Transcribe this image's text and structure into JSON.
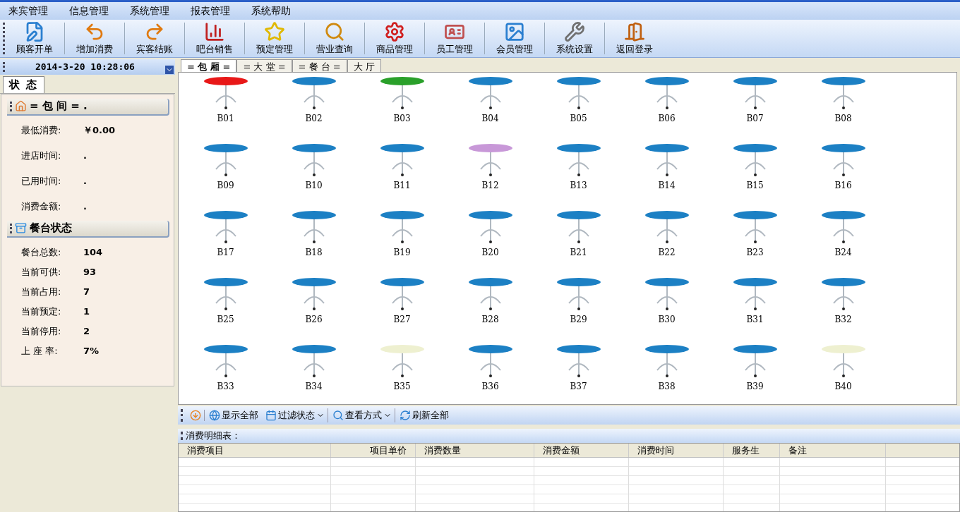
{
  "menu": [
    "来宾管理",
    "信息管理",
    "系统管理",
    "报表管理",
    "系统帮助"
  ],
  "toolbar": [
    "顾客开单",
    "增加消费",
    "宾客结账",
    "吧台销售",
    "预定管理",
    "营业查询",
    "商品管理",
    "员工管理",
    "会员管理",
    "系统设置",
    "返回登录"
  ],
  "clock": "2014-3-20  10:28:06",
  "left_tabs": [
    {
      "label": "状 态",
      "selected": true
    }
  ],
  "room_section": {
    "title": "= 包 间 = .",
    "fields": [
      {
        "label": "最低消费:",
        "value": "￥0.00"
      },
      {
        "label": "进店时间:",
        "value": "."
      },
      {
        "label": "已用时间:",
        "value": "."
      },
      {
        "label": "消费金额:",
        "value": "."
      }
    ]
  },
  "status_section": {
    "title": "餐台状态",
    "fields": [
      {
        "label": "餐台总数:",
        "value": "104"
      },
      {
        "label": "当前可供:",
        "value": "93"
      },
      {
        "label": "当前占用:",
        "value": "7"
      },
      {
        "label": "当前预定:",
        "value": "1"
      },
      {
        "label": "当前停用:",
        "value": "2"
      },
      {
        "label": "上 座 率:",
        "value": "7%"
      }
    ]
  },
  "area_tabs": [
    {
      "label": "= 包 厢 =",
      "selected": true
    },
    {
      "label": "= 大 堂 =",
      "selected": false
    },
    {
      "label": "= 餐 台 =",
      "selected": false
    },
    {
      "label": "大 厅",
      "selected": false
    }
  ],
  "tables": [
    {
      "name": "B01",
      "color": "#e81818"
    },
    {
      "name": "B02",
      "color": "#1c80c4"
    },
    {
      "name": "B03",
      "color": "#2aa02a"
    },
    {
      "name": "B04",
      "color": "#1c80c4"
    },
    {
      "name": "B05",
      "color": "#1c80c4"
    },
    {
      "name": "B06",
      "color": "#1c80c4"
    },
    {
      "name": "B07",
      "color": "#1c80c4"
    },
    {
      "name": "B08",
      "color": "#1c80c4"
    },
    {
      "name": "B09",
      "color": "#1c80c4"
    },
    {
      "name": "B10",
      "color": "#1c80c4"
    },
    {
      "name": "B11",
      "color": "#1c80c4"
    },
    {
      "name": "B12",
      "color": "#c898d8"
    },
    {
      "name": "B13",
      "color": "#1c80c4"
    },
    {
      "name": "B14",
      "color": "#1c80c4"
    },
    {
      "name": "B15",
      "color": "#1c80c4"
    },
    {
      "name": "B16",
      "color": "#1c80c4"
    },
    {
      "name": "B17",
      "color": "#1c80c4"
    },
    {
      "name": "B18",
      "color": "#1c80c4"
    },
    {
      "name": "B19",
      "color": "#1c80c4"
    },
    {
      "name": "B20",
      "color": "#1c80c4"
    },
    {
      "name": "B21",
      "color": "#1c80c4"
    },
    {
      "name": "B22",
      "color": "#1c80c4"
    },
    {
      "name": "B23",
      "color": "#1c80c4"
    },
    {
      "name": "B24",
      "color": "#1c80c4"
    },
    {
      "name": "B25",
      "color": "#1c80c4"
    },
    {
      "name": "B26",
      "color": "#1c80c4"
    },
    {
      "name": "B27",
      "color": "#1c80c4"
    },
    {
      "name": "B28",
      "color": "#1c80c4"
    },
    {
      "name": "B29",
      "color": "#1c80c4"
    },
    {
      "name": "B30",
      "color": "#1c80c4"
    },
    {
      "name": "B31",
      "color": "#1c80c4"
    },
    {
      "name": "B32",
      "color": "#1c80c4"
    },
    {
      "name": "B33",
      "color": "#1c80c4"
    },
    {
      "name": "B34",
      "color": "#1c80c4"
    },
    {
      "name": "B35",
      "color": "#eef0d0"
    },
    {
      "name": "B36",
      "color": "#1c80c4"
    },
    {
      "name": "B37",
      "color": "#1c80c4"
    },
    {
      "name": "B38",
      "color": "#1c80c4"
    },
    {
      "name": "B39",
      "color": "#1c80c4"
    },
    {
      "name": "B40",
      "color": "#eef0d0"
    }
  ],
  "bottom_toolbar": [
    {
      "kind": "icon"
    },
    {
      "kind": "button",
      "label": "显示全部"
    },
    {
      "kind": "dropdown",
      "label": "过滤状态"
    },
    {
      "kind": "dropdown",
      "label": "查看方式"
    },
    {
      "kind": "button",
      "label": "刷新全部"
    }
  ],
  "detail": {
    "title": "消费明细表：",
    "columns": [
      "消费项目",
      "项目单价",
      "消费数量",
      "消费金额",
      "消费时间",
      "服务生",
      "备注"
    ]
  }
}
